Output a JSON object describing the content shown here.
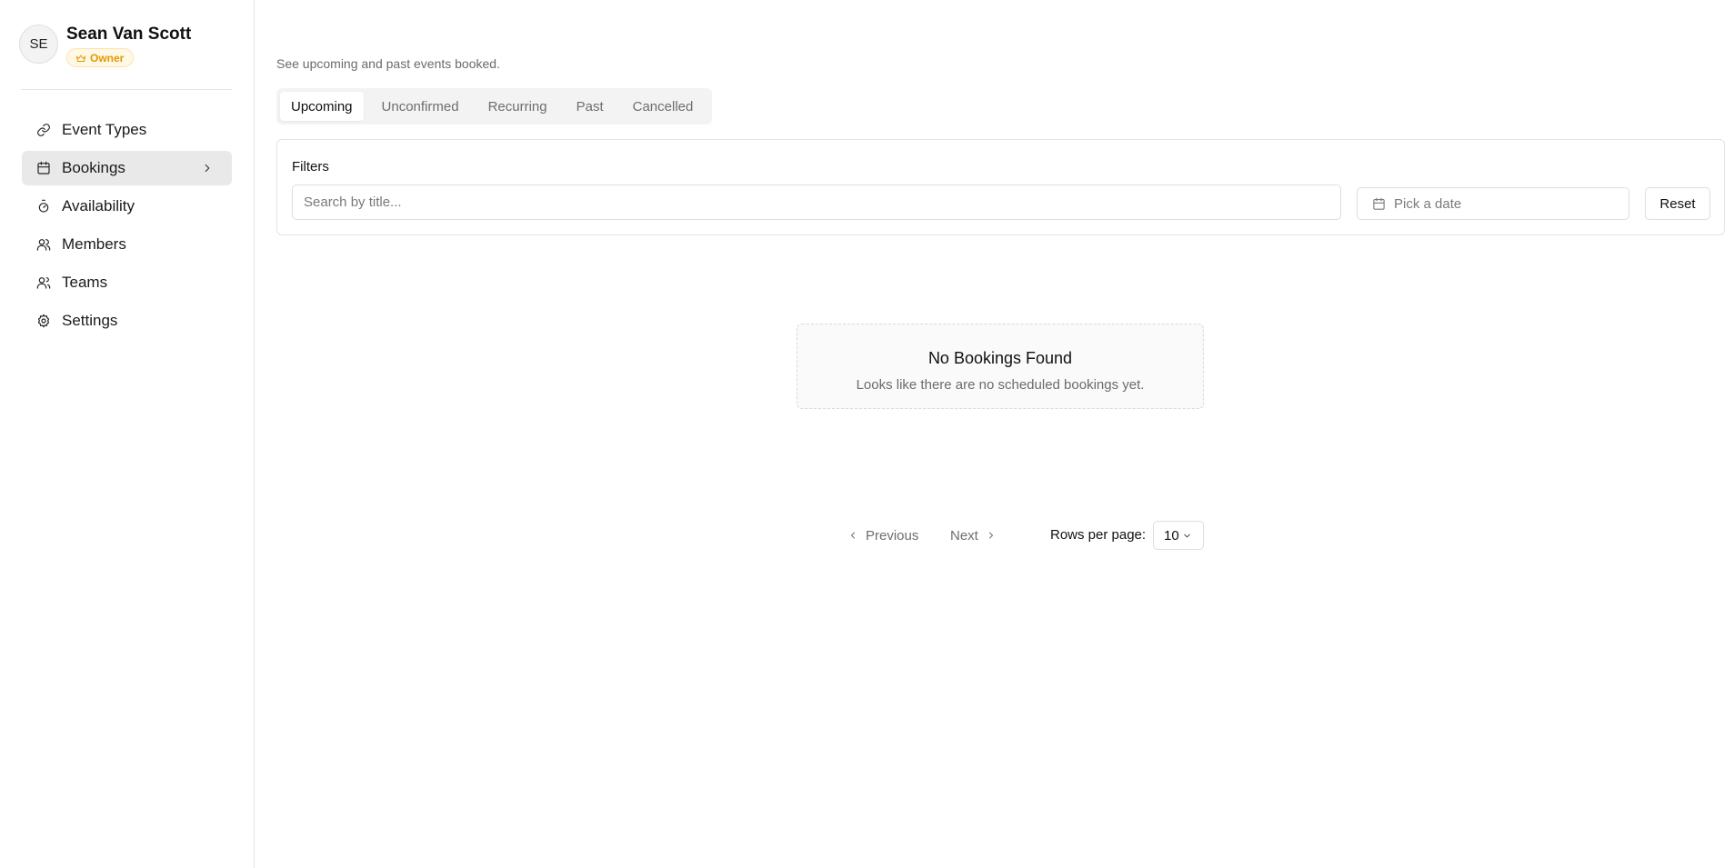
{
  "user": {
    "initials": "SE",
    "name": "Sean Van Scott",
    "role": "Owner"
  },
  "sidebar": {
    "items": [
      {
        "label": "Event Types",
        "icon": "link-icon"
      },
      {
        "label": "Bookings",
        "icon": "calendar-icon",
        "active": true
      },
      {
        "label": "Availability",
        "icon": "timer-icon"
      },
      {
        "label": "Members",
        "icon": "users-icon"
      },
      {
        "label": "Teams",
        "icon": "team-icon"
      },
      {
        "label": "Settings",
        "icon": "gear-icon"
      }
    ]
  },
  "page": {
    "subtitle": "See upcoming and past events booked."
  },
  "tabs": [
    {
      "label": "Upcoming",
      "active": true
    },
    {
      "label": "Unconfirmed"
    },
    {
      "label": "Recurring"
    },
    {
      "label": "Past"
    },
    {
      "label": "Cancelled"
    }
  ],
  "filters": {
    "label": "Filters",
    "search_placeholder": "Search by title...",
    "date_placeholder": "Pick a date",
    "reset_label": "Reset"
  },
  "empty_state": {
    "title": "No Bookings Found",
    "message": "Looks like there are no scheduled bookings yet."
  },
  "pagination": {
    "previous_label": "Previous",
    "next_label": "Next",
    "rows_label": "Rows per page:",
    "rows_value": "10"
  },
  "colors": {
    "owner_badge_text": "#e19a00",
    "owner_badge_bg": "#fff8e6",
    "active_nav_bg": "#e9e9e9",
    "tab_bar_bg": "#f3f3f3"
  }
}
